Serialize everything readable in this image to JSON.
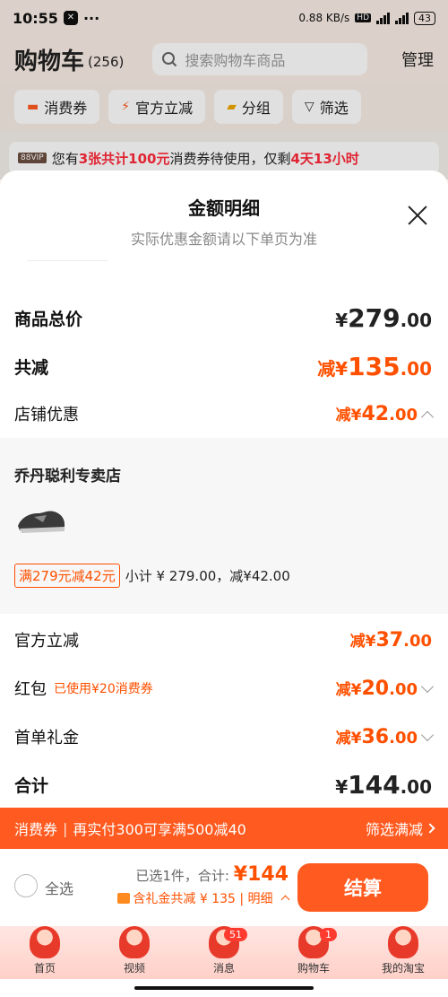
{
  "status_bar": {
    "time": "10:55",
    "net_speed": "0.88 KB/s",
    "hd": "HD",
    "battery": "43"
  },
  "header": {
    "title": "购物车",
    "count": "(256)",
    "search_placeholder": "搜索购物车商品",
    "manage": "管理"
  },
  "chips": [
    "消费券",
    "官方立减",
    "分组",
    "筛选"
  ],
  "notice": {
    "vip": "88VIP",
    "prefix": "您有",
    "highlight1": "3张共计100元",
    "middle": "消费券待使用，仅剩",
    "highlight2": "4天13小时"
  },
  "sheet": {
    "title": "金额明细",
    "subtitle": "实际优惠金额请以下单页为准",
    "total_goods": {
      "label": "商品总价",
      "currency": "¥",
      "int": "279",
      "dec": ".00"
    },
    "total_reduce": {
      "label": "共减",
      "prefix": "减¥",
      "int": "135",
      "dec": ".00"
    },
    "shop_discount": {
      "label": "店铺优惠",
      "prefix": "减¥",
      "int": "42",
      "dec": ".00"
    },
    "store": {
      "name": "乔丹聪利专卖店",
      "promo_tag": "满279元减42元",
      "subtotal": "小计 ¥ 279.00，减¥42.00"
    },
    "official": {
      "label": "官方立减",
      "prefix": "减¥",
      "int": "37",
      "dec": ".00"
    },
    "red_packet": {
      "label": "红包",
      "note": "已使用¥20消费券",
      "prefix": "减¥",
      "int": "20",
      "dec": ".00"
    },
    "first_gift": {
      "label": "首单礼金",
      "prefix": "减¥",
      "int": "36",
      "dec": ".00"
    },
    "sum": {
      "label": "合计",
      "currency": "¥",
      "int": "144",
      "dec": ".00"
    }
  },
  "coupon_bar": {
    "label": "消费券",
    "text": "再实付300可享满500减40",
    "action": "筛选满减"
  },
  "checkout": {
    "select_all": "全选",
    "selected": "已选1件，合计:",
    "total": "¥144",
    "gift_line": "含礼金共减 ¥ 135 | 明细",
    "pay": "结算"
  },
  "tabs": [
    {
      "label": "首页",
      "badge": ""
    },
    {
      "label": "视频",
      "badge": ""
    },
    {
      "label": "消息",
      "badge": "51"
    },
    {
      "label": "购物车",
      "badge": "1"
    },
    {
      "label": "我的淘宝",
      "badge": ""
    }
  ],
  "colors": {
    "accent": "#ff5000",
    "bar": "#ff5a1f",
    "notice_red": "#ff2a3b"
  }
}
